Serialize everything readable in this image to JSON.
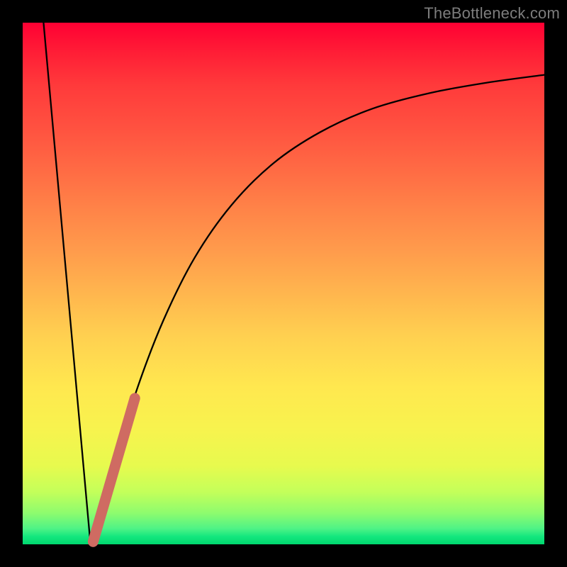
{
  "watermark": "TheBottleneck.com",
  "chart_data": {
    "type": "line",
    "title": "",
    "xlabel": "",
    "ylabel": "",
    "xlim": [
      0,
      100
    ],
    "ylim": [
      0,
      100
    ],
    "grid": false,
    "background_gradient": {
      "top_color": "#ff0033",
      "mid_color": "#ffd050",
      "bottom_color": "#00d86f"
    },
    "series": [
      {
        "name": "left-falling-line",
        "style": "thin-black",
        "points": [
          {
            "x": 4,
            "y": 100
          },
          {
            "x": 13,
            "y": 0
          }
        ]
      },
      {
        "name": "right-rising-curve",
        "style": "thin-black",
        "points": [
          {
            "x": 13,
            "y": 0
          },
          {
            "x": 15,
            "y": 7
          },
          {
            "x": 18,
            "y": 17
          },
          {
            "x": 22,
            "y": 30
          },
          {
            "x": 27,
            "y": 43
          },
          {
            "x": 33,
            "y": 55
          },
          {
            "x": 40,
            "y": 65
          },
          {
            "x": 48,
            "y": 73
          },
          {
            "x": 57,
            "y": 79
          },
          {
            "x": 67,
            "y": 83.5
          },
          {
            "x": 78,
            "y": 86.5
          },
          {
            "x": 89,
            "y": 88.5
          },
          {
            "x": 100,
            "y": 90
          }
        ]
      },
      {
        "name": "highlighted-segment",
        "style": "thick-salmon",
        "color": "#cf6b62",
        "points": [
          {
            "x": 13.5,
            "y": 0.5
          },
          {
            "x": 21.5,
            "y": 28
          }
        ]
      }
    ],
    "annotations": []
  }
}
